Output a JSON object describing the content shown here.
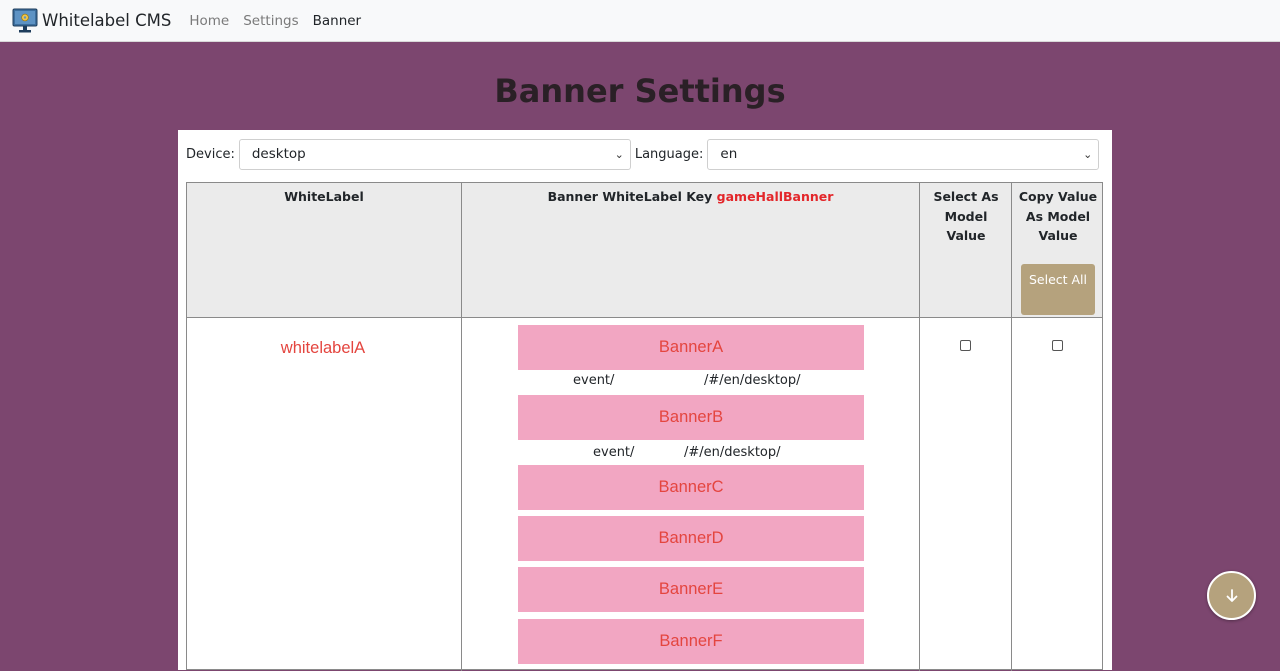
{
  "nav": {
    "brand": "Whitelabel CMS",
    "links": [
      "Home",
      "Settings",
      "Banner"
    ]
  },
  "page": {
    "title": "Banner Settings"
  },
  "filters": {
    "device_label": "Device:",
    "device_value": "desktop",
    "language_label": "Language:",
    "language_value": "en"
  },
  "table": {
    "headers": {
      "whitelabel": "WhiteLabel",
      "banner_key_prefix": "Banner WhiteLabel Key",
      "banner_key": "gameHallBanner",
      "select_model": "Select As Model Value",
      "copy_model": "Copy Value As Model Value",
      "select_all": "Select All"
    },
    "rows": [
      {
        "whitelabel": "whitelabelA",
        "banners": [
          "BannerA",
          "BannerB",
          "BannerC",
          "BannerD",
          "BannerE",
          "BannerF"
        ],
        "urls": [
          {
            "left": "event/",
            "right": "/#/en/desktop/"
          },
          {
            "left": "event/",
            "right": "/#/en/desktop/"
          }
        ]
      }
    ]
  },
  "colors": {
    "background": "#7c466f",
    "accent": "#b5a27d",
    "banner_bg": "#f2a6c2",
    "banner_text": "#e4453f",
    "key_text": "#e3262a"
  },
  "icons": {
    "brand": "monitor-gear-icon",
    "fab": "arrow-down-icon"
  }
}
